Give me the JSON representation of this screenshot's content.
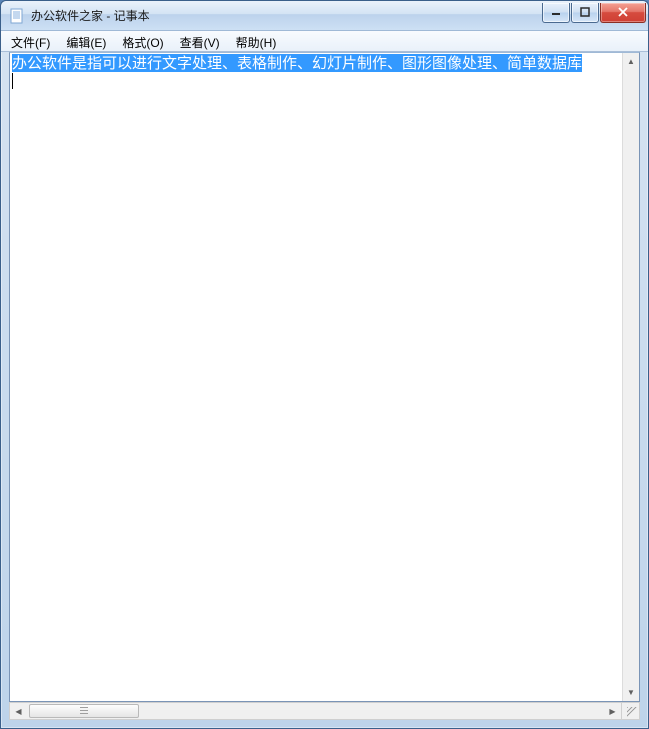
{
  "window": {
    "title": "办公软件之家 - 记事本",
    "app_icon": "notepad-icon"
  },
  "menubar": {
    "items": [
      {
        "label": "文件(F)"
      },
      {
        "label": "编辑(E)"
      },
      {
        "label": "格式(O)"
      },
      {
        "label": "查看(V)"
      },
      {
        "label": "帮助(H)"
      }
    ]
  },
  "editor": {
    "selected_text": "办公软件是指可以进行文字处理、表格制作、幻灯片制作、图形图像处理、简单数据库"
  }
}
